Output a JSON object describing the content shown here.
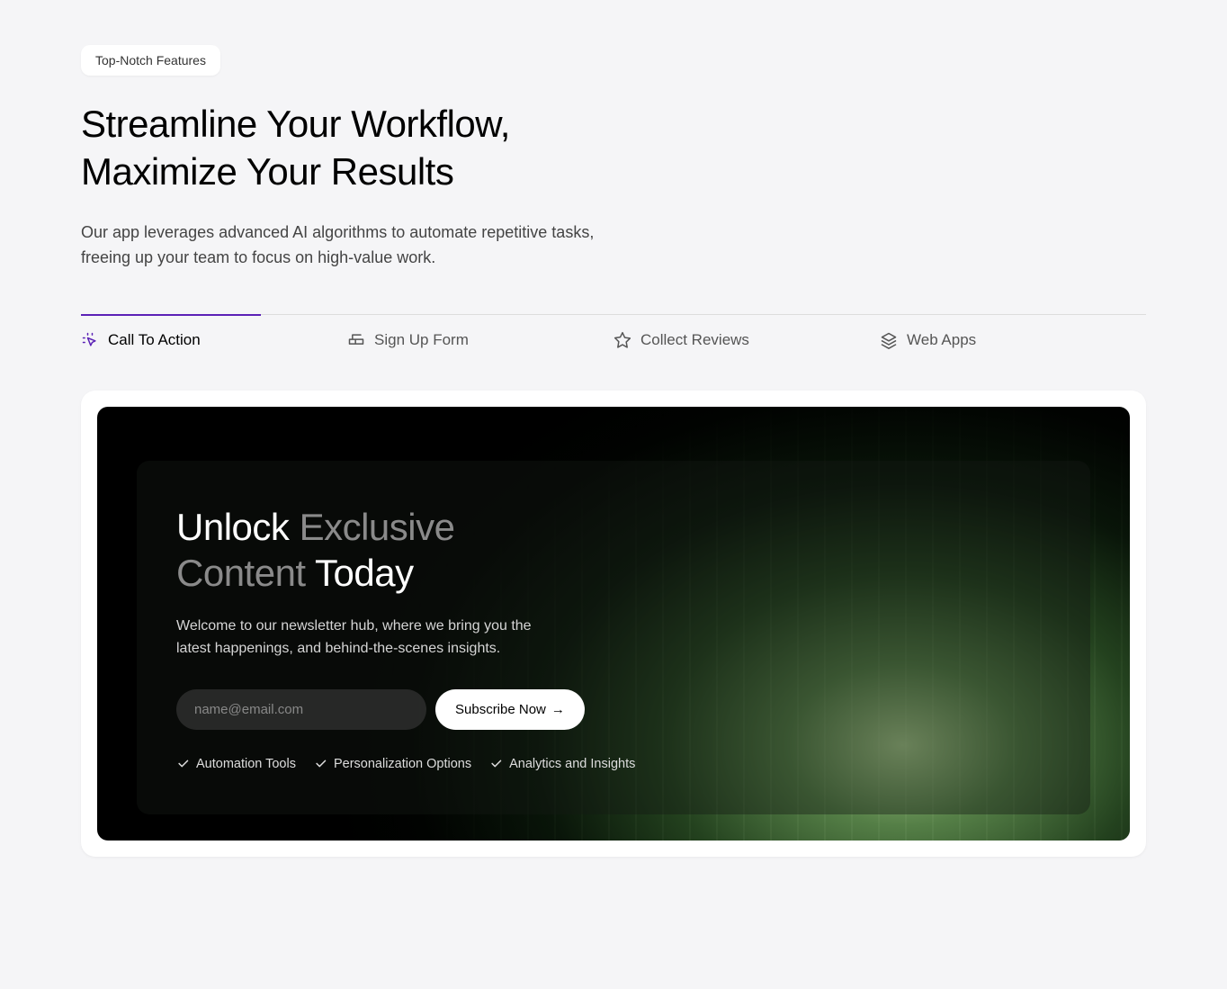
{
  "badge": "Top-Notch Features",
  "headline_line1": "Streamline Your Workflow,",
  "headline_line2": "Maximize Your Results",
  "description": "Our app leverages advanced AI algorithms to automate repetitive tasks, freeing up your team to focus on high-value work.",
  "tabs": [
    {
      "label": "Call To Action",
      "icon": "cursor-click"
    },
    {
      "label": "Sign Up Form",
      "icon": "mailbox"
    },
    {
      "label": "Collect Reviews",
      "icon": "star"
    },
    {
      "label": "Web Apps",
      "icon": "layers"
    }
  ],
  "hero": {
    "title_word1": "Unlock",
    "title_word2": "Exclusive",
    "title_word3": "Content",
    "title_word4": "Today",
    "subtitle": "Welcome to our newsletter hub, where we bring you the latest happenings, and behind-the-scenes insights.",
    "email_placeholder": "name@email.com",
    "subscribe_label": "Subscribe Now",
    "features": [
      "Automation Tools",
      "Personalization Options",
      "Analytics and Insights"
    ]
  }
}
